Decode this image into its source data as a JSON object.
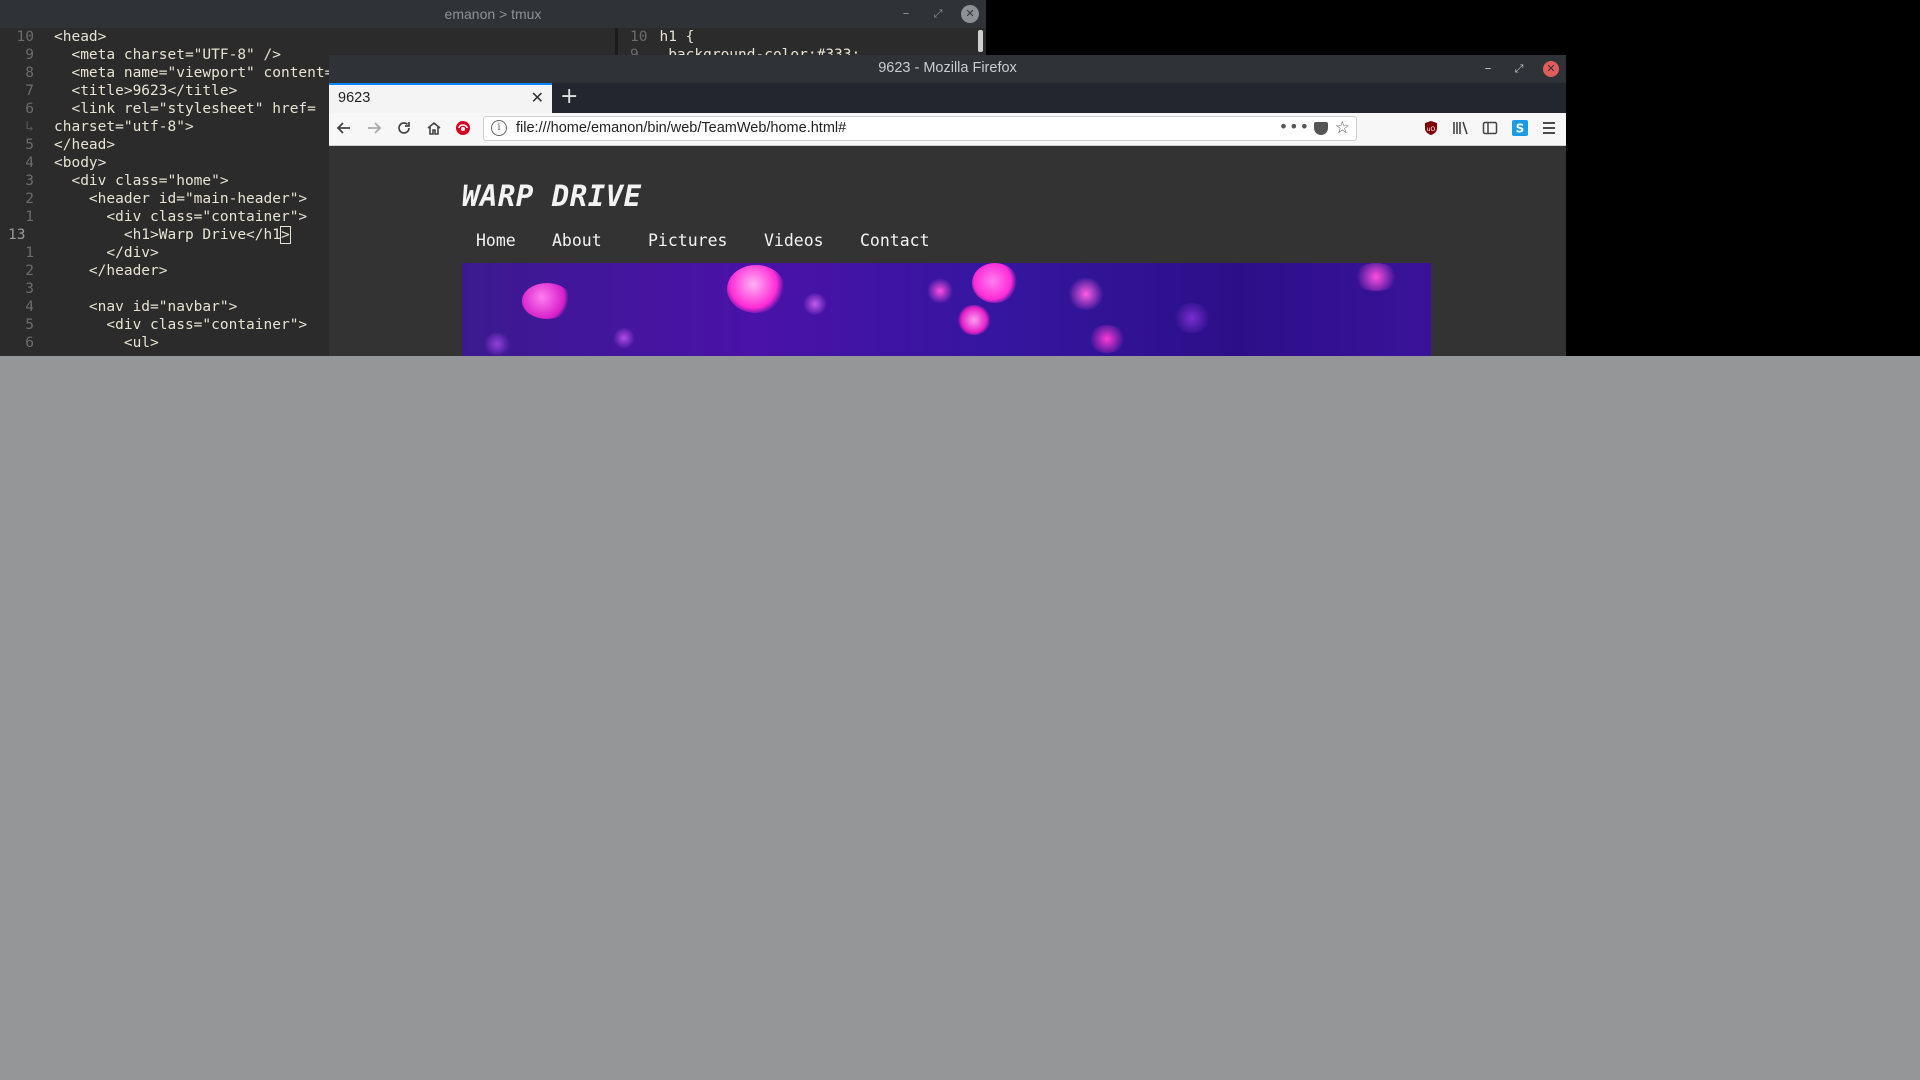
{
  "terminal": {
    "title": "emanon > tmux",
    "buttons": {
      "minimize": "–",
      "maximize": "⤢",
      "close": "✕"
    },
    "html_pane": {
      "lines": [
        {
          "num": "10",
          "text": "<head>",
          "indent": 0
        },
        {
          "num": "9",
          "text": "  <meta charset=\"UTF-8\" />",
          "indent": 0
        },
        {
          "num": "8",
          "text": "  <meta name=\"viewport\" content=",
          "indent": 0
        },
        {
          "num": "7",
          "text": "  <title>9623</title>",
          "indent": 0
        },
        {
          "num": "6",
          "text": "  <link rel=\"stylesheet\" href=",
          "indent": 0
        },
        {
          "num": "",
          "text": "charset=\"utf-8\">",
          "indent": 0
        },
        {
          "num": "5",
          "text": "</head>",
          "indent": 0
        },
        {
          "num": "4",
          "text": "<body>",
          "indent": 0
        },
        {
          "num": "3",
          "text": "  <div class=\"home\">",
          "indent": 0
        },
        {
          "num": "2",
          "text": "    <header id=\"main-header\">",
          "indent": 0
        },
        {
          "num": "1",
          "text": "      <div class=\"container\">",
          "indent": 0
        },
        {
          "num": "13",
          "text": "        <h1>Warp Drive</h1",
          "indent": 0
        },
        {
          "num": "1",
          "text": "      </div>",
          "indent": 0
        },
        {
          "num": "2",
          "text": "    </header>",
          "indent": 0
        },
        {
          "num": "3",
          "text": "",
          "indent": 0
        },
        {
          "num": "4",
          "text": "    <nav id=\"navbar\">",
          "indent": 0
        },
        {
          "num": "5",
          "text": "      <div class=\"container\">",
          "indent": 0
        },
        {
          "num": "6",
          "text": "        <ul>",
          "indent": 0
        }
      ],
      "cursor_char": ">"
    },
    "css_pane": {
      "lines": [
        {
          "num": "10",
          "text": "h1 {"
        },
        {
          "num": "9",
          "text": "  background-color:#333;"
        }
      ]
    }
  },
  "firefox": {
    "window_title": "9623 - Mozilla Firefox",
    "tab_title": "9623",
    "new_tab": "+",
    "url": "file:///home/emanon/bin/web/TeamWeb/home.html#",
    "buttons": {
      "minimize": "–",
      "maximize": "⤢",
      "close": "✕"
    },
    "toolbar_icons": [
      "back-icon",
      "forward-icon",
      "reload-icon",
      "home-icon",
      "addon-icon",
      "ublock-icon",
      "library-icon",
      "sidebar-icon",
      "sync-icon",
      "menu-icon"
    ]
  },
  "site": {
    "heading": "WARP DRIVE",
    "nav": [
      "Home",
      "About",
      "Pictures",
      "Videos",
      "Contact"
    ],
    "hero_colors": [
      "#3b1a8f",
      "#ff2bd6"
    ]
  }
}
